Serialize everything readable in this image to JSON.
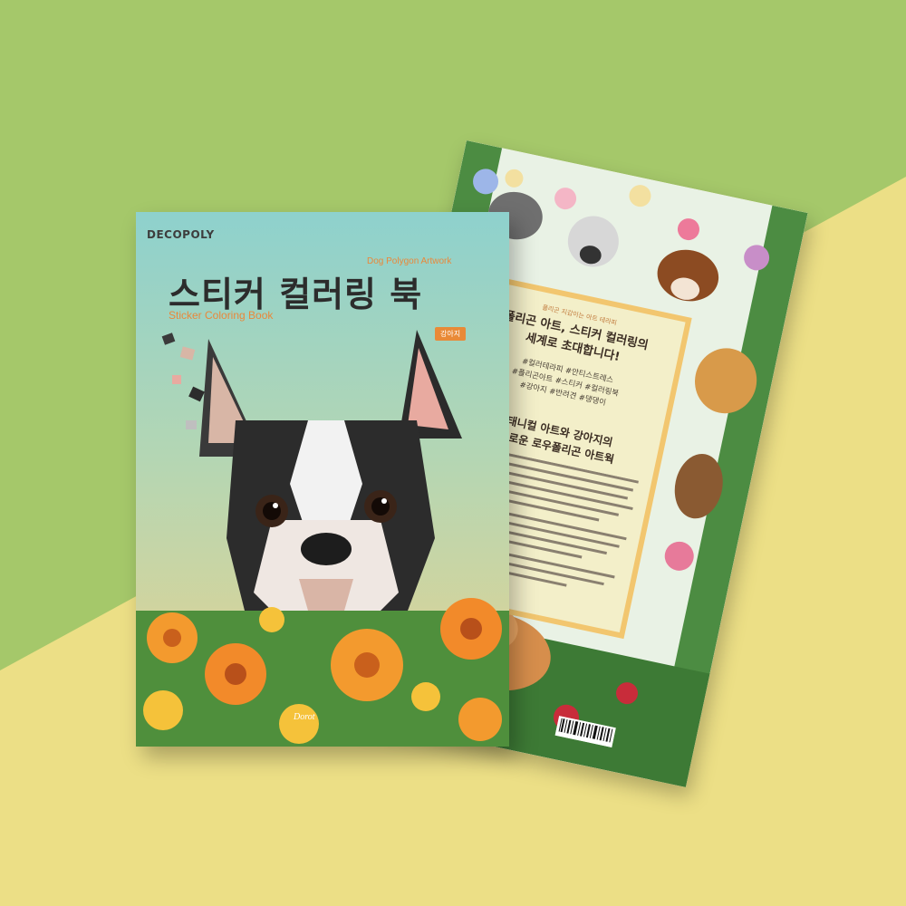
{
  "front_cover": {
    "brand": "DECOPOLY",
    "subtitle_en": "Dog Polygon Artwork",
    "title_ko": "스티커 컬러링 북",
    "subtitle_en2": "Sticker Coloring Book",
    "tag": "강아지",
    "publisher": "Dorot"
  },
  "back_cover": {
    "small_header": "폴리곤 지갑이는 아트 테라피",
    "headline_1": "폴리곤 아트, 스티커 컬러링의",
    "headline_2": "세계로 초대합니다!",
    "hashtags_1": "#컬러테라피 #안티스트레스",
    "hashtags_2": "#폴리곤아트 #스티커 #컬러링북",
    "hashtags_3": "#강아지 #반려견 #댕댕이",
    "headline_3": "보태니컬 아트와 강아지의",
    "headline_4": "조화로운 로우폴리곤 아트웍"
  },
  "colors": {
    "bg_green": "#a5c86a",
    "bg_yellow": "#ecdf86",
    "accent_orange": "#e98a37"
  }
}
